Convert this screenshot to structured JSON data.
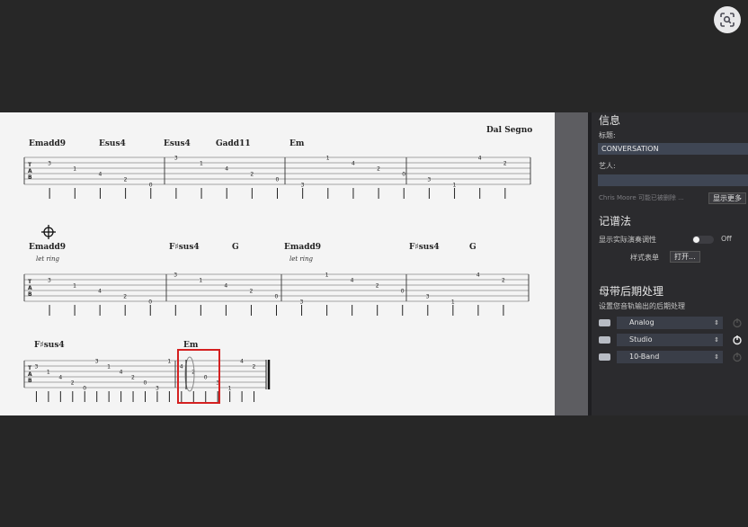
{
  "lens_icon": "visual-search-icon",
  "score": {
    "dal_segno": "Dal Segno",
    "let_ring": "let ring",
    "rows": [
      {
        "chords": [
          "Emadd9",
          "Esus4",
          "Esus4",
          "Gadd11",
          "Em"
        ]
      },
      {
        "chords": [
          "Emadd9",
          "F♯sus4",
          "G",
          "Emadd9",
          "F♯sus4",
          "G"
        ]
      },
      {
        "chords": [
          "F♯sus4",
          "Em"
        ]
      }
    ],
    "tab_label": [
      "T",
      "A",
      "B"
    ],
    "highlight_color": "#d42020"
  },
  "panel": {
    "info_heading": "信息",
    "title_label": "标题:",
    "title_value": "CONVERSATION",
    "artist_label": "艺人:",
    "artist_value": "",
    "dim_text": "Chris Moore  可能已被删除 ...",
    "show_more_button": "显示更多",
    "notation_heading": "记谱法",
    "show_dynamics_label": "显示实际演奏调性",
    "toggle_state": "Off",
    "style_sheet_label": "样式表单",
    "open_button": "打开...",
    "mastering_heading": "母带后期处理",
    "mastering_desc": "设置您音轨输出的后期处理",
    "effects": [
      {
        "name": "Analog",
        "power": "power-icon-dim"
      },
      {
        "name": "Studio",
        "power": "power-icon-on"
      },
      {
        "name": "10-Band",
        "power": "power-icon-dim"
      }
    ]
  }
}
